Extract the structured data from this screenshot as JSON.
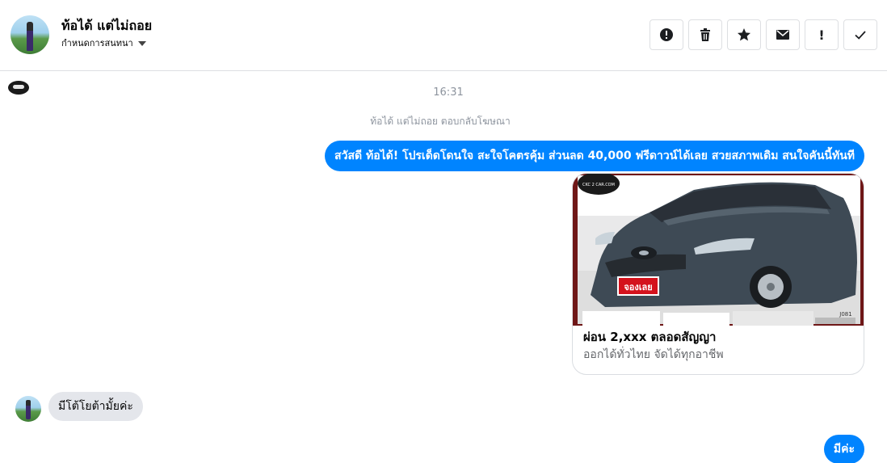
{
  "header": {
    "name": "ท้อได้ แต่ไม่ถอย",
    "subtitle": "กำหนดการสนทนา",
    "icons": [
      "alert-circle-icon",
      "trash-icon",
      "star-icon",
      "envelope-icon",
      "exclamation-icon",
      "check-icon"
    ],
    "exclamation_glyph": "!"
  },
  "conversation": {
    "timestamp": "16:31",
    "system_note": "ท้อได้ แต่ไม่ถอย ตอบกลับโฆษณา",
    "messages": [
      {
        "from": "page",
        "text": "สวัสดี ท้อได้! โปรเด็ดโดนใจ สะใจโคตรคุ้ม ส่วนลด 40,000 ฟรีดาวน์ได้เลย สวยสภาพเดิม สนใจคันนี้ทันที"
      },
      {
        "from": "user",
        "text": "มีโต้โยต้ามั้ยค่ะ"
      },
      {
        "from": "page",
        "text": "มีค่ะ"
      }
    ],
    "ad_card": {
      "title": "ผ่อน 2,xxx ตลอดสัญญา",
      "subtitle": "ออกได้ทั่วไทย จัดได้ทุกอาชีพ",
      "logo_text": "CKC 2 CAR.COM",
      "stamp_text": "จองเลย",
      "code_text": "J081"
    }
  },
  "colors": {
    "outgoing_bubble": "#0084ff",
    "incoming_bubble": "#e4e6eb",
    "muted_text": "#8d949e",
    "card_frame": "#6f1717"
  }
}
